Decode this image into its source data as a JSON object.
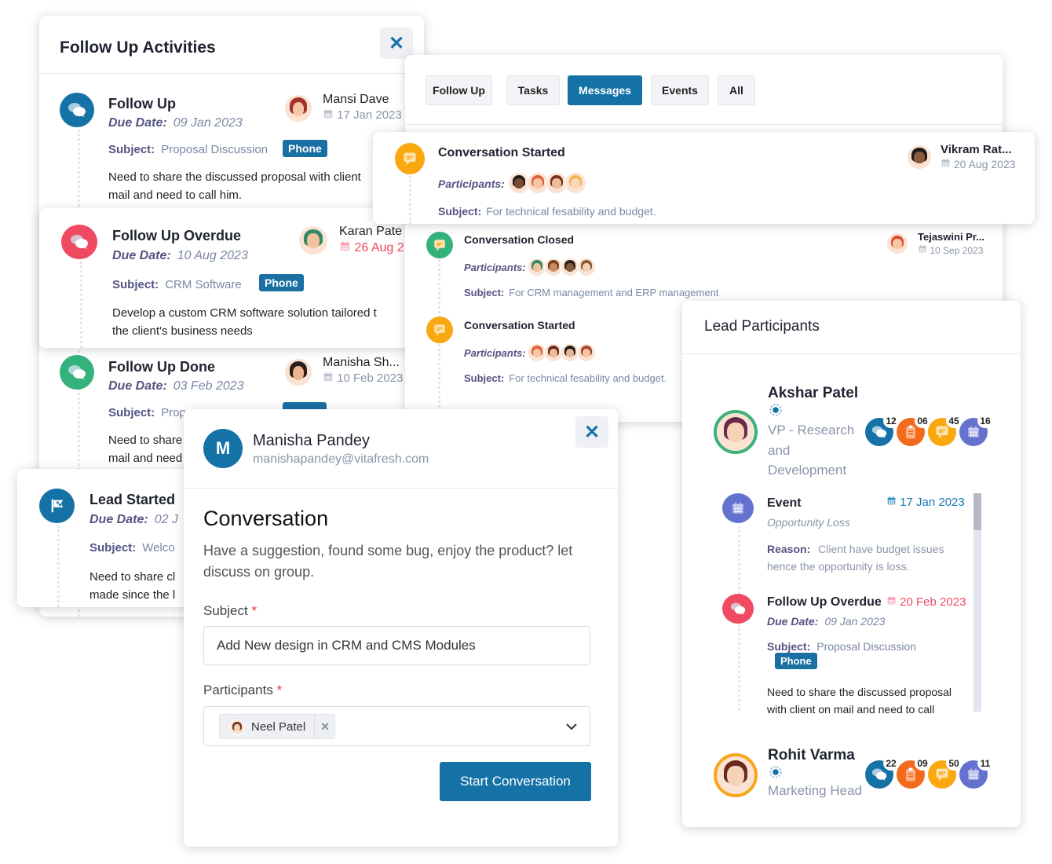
{
  "follow_up_panel": {
    "title": "Follow Up Activities",
    "close_icon": "close-icon",
    "items": [
      {
        "title": "Follow Up",
        "due_label": "Due Date:",
        "due": "09 Jan 2023",
        "user": "Mansi Dave",
        "date": "17 Jan 2023",
        "subject_label": "Subject:",
        "subject": "Proposal Discussion",
        "badge": "Phone",
        "desc1": "Need to share the discussed proposal with client",
        "desc2": "mail and need to call him.",
        "icon": "chat-icon",
        "color": "#1572a6"
      },
      {
        "title": "Follow Up Overdue",
        "due_label": "Due Date:",
        "due": "10 Aug 2023",
        "user": "Karan Pate",
        "date": "26 Aug 2",
        "subject_label": "Subject:",
        "subject": "CRM Software",
        "badge": "Phone",
        "desc1": "Develop a custom CRM software solution tailored t",
        "desc2": "the client's business needs",
        "icon": "chat-icon",
        "color": "#f04a62"
      },
      {
        "title": "Follow Up Done",
        "due_label": "Due Date:",
        "due": "03 Feb 2023",
        "user": "Manisha Sh...",
        "date": "10 Feb 2023",
        "subject_label": "Subject:",
        "subject": "Prop",
        "desc1": "Need to share",
        "desc2": "mail and need",
        "icon": "chat-icon",
        "color": "#35b27c"
      },
      {
        "title": "Lead Started",
        "due_label": "Due Date:",
        "due": "02 J",
        "subject_label": "Subject:",
        "subject": "Welco",
        "desc1": "Need to share cl",
        "desc2": "made since the l",
        "icon": "flag-icon",
        "color": "#1572a6"
      }
    ]
  },
  "messages_panel": {
    "tabs": [
      "Follow Up",
      "Tasks",
      "Messages",
      "Events",
      "All"
    ],
    "active_tab": "Messages",
    "items": [
      {
        "title": "Conversation Started",
        "participants_label": "Participants:",
        "subject_label": "Subject:",
        "subject": "For technical fesability and budget.",
        "user": "Vikram Rat...",
        "date": "20 Aug 2023",
        "color": "#f9a80f"
      },
      {
        "title": "Conversation Closed",
        "participants_label": "Participants:",
        "subject_label": "Subject:",
        "subject": "For CRM management and ERP management",
        "user": "Tejaswini Pr...",
        "date": "10 Sep 2023",
        "color": "#35b27c"
      },
      {
        "title": "Conversation Started",
        "participants_label": "Participants:",
        "subject_label": "Subject:",
        "subject": "For technical fesability and budget.",
        "color": "#f9a80f"
      }
    ]
  },
  "lead_participants": {
    "title": "Lead Participants",
    "people": [
      {
        "name": "Akshar Patel",
        "role1": "VP - Research",
        "role2": "and",
        "role3": "Development",
        "counts": [
          "12",
          "06",
          "45",
          "16"
        ]
      },
      {
        "name": "Rohit Varma",
        "role1": "Marketing Head",
        "counts": [
          "22",
          "09",
          "50",
          "11"
        ]
      }
    ],
    "activities": [
      {
        "title": "Event",
        "date": "17 Jan 2023",
        "sub": "Opportunity Loss",
        "reason_label": "Reason:",
        "reason1": "Client have budget issues",
        "reason2": "hence the opportunity is loss."
      },
      {
        "title": "Follow Up Overdue",
        "date": "20 Feb 2023",
        "due_label": "Due Date:",
        "due": "09 Jan 2023",
        "subject_label": "Subject:",
        "subject": "Proposal Discussion",
        "badge": "Phone",
        "desc1": "Need to share the discussed proposal",
        "desc2": "with client on mail and need to call"
      }
    ]
  },
  "conversation_modal": {
    "avatar_letter": "M",
    "name": "Manisha Pandey",
    "email": "manishapandey@vitafresh.com",
    "title": "Conversation",
    "desc1": "Have a suggestion, found some bug, enjoy the product? let",
    "desc2": "discuss on group.",
    "subject_label": "Subject",
    "subject_value": "Add New design in CRM and CMS Modules",
    "participants_label": "Participants",
    "required_mark": "*",
    "chip": "Neel Patel",
    "chip_remove": "×",
    "submit": "Start Conversation"
  },
  "colors": {
    "primary": "#1572a6",
    "danger": "#f04a62",
    "success": "#35b27c",
    "warning": "#f9a80f",
    "event": "#6471cf",
    "task": "#f26a1b"
  }
}
